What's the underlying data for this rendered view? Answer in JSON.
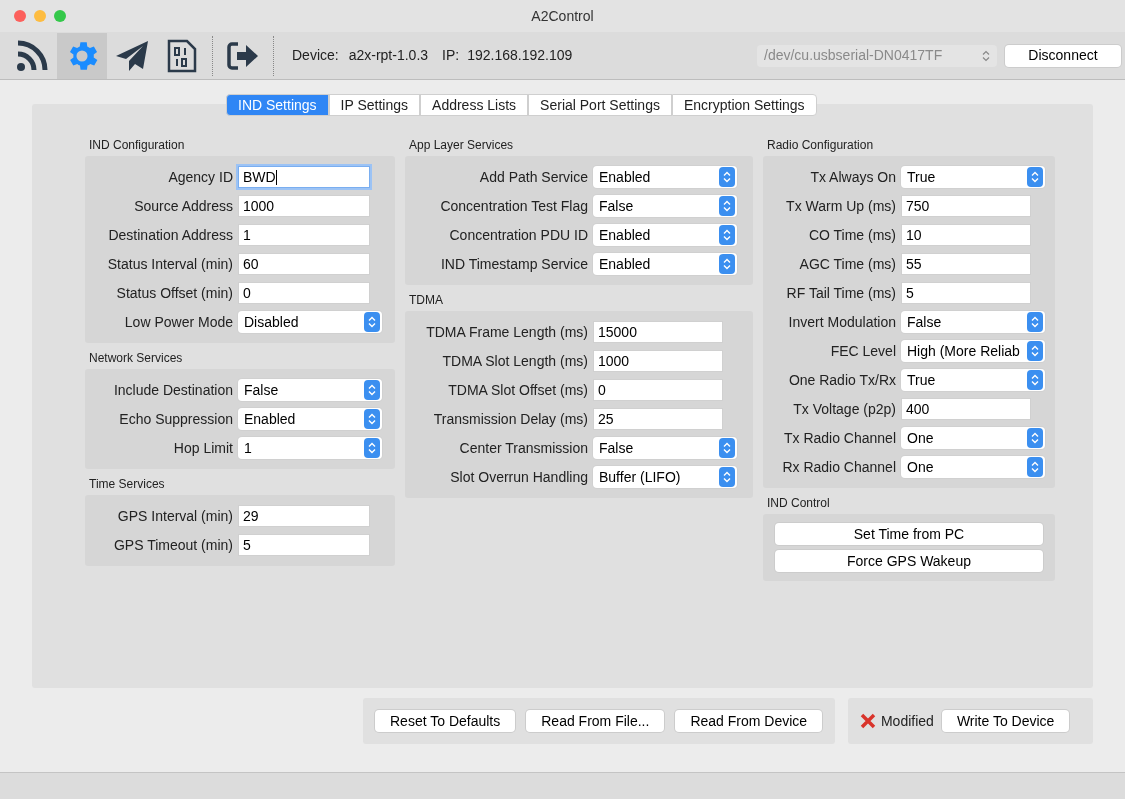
{
  "window": {
    "title": "A2Control"
  },
  "toolbar": {
    "icons": [
      {
        "kind": "feed",
        "selected": false
      },
      {
        "kind": "gear",
        "selected": true
      },
      {
        "kind": "plane",
        "selected": false
      },
      {
        "kind": "sim",
        "selected": false
      },
      {
        "kind": "exit",
        "selected": false
      }
    ],
    "device_label": "Device:",
    "device": "a2x-rpt-1.0.3",
    "ip_label": "IP:",
    "ip": "192.168.192.109",
    "port": {
      "value": "/dev/cu.usbserial-DN0417TF",
      "disabled": true
    },
    "connect_button": "Disconnect"
  },
  "tabs": [
    {
      "label": "IND Settings",
      "selected": true
    },
    {
      "label": "IP Settings",
      "selected": false
    },
    {
      "label": "Address Lists",
      "selected": false
    },
    {
      "label": "Serial Port Settings",
      "selected": false
    },
    {
      "label": "Encryption Settings",
      "selected": false
    }
  ],
  "columns": [
    [
      {
        "title": "IND Configuration",
        "rows": [
          {
            "label": "Agency ID",
            "kind": "text",
            "value": "BWD",
            "focused": true
          },
          {
            "label": "Source Address",
            "kind": "text",
            "value": "1000",
            "focused": false
          },
          {
            "label": "Destination Address",
            "kind": "text",
            "value": "1",
            "focused": false
          },
          {
            "label": "Status Interval (min)",
            "kind": "text",
            "value": "60",
            "focused": false
          },
          {
            "label": "Status Offset (min)",
            "kind": "text",
            "value": "0",
            "focused": false
          },
          {
            "label": "Low Power Mode",
            "kind": "select",
            "value": "Disabled"
          }
        ]
      },
      {
        "title": "Network Services",
        "rows": [
          {
            "label": "Include Destination",
            "kind": "select",
            "value": "False"
          },
          {
            "label": "Echo Suppression",
            "kind": "select",
            "value": "Enabled"
          },
          {
            "label": "Hop Limit",
            "kind": "select",
            "value": "1"
          }
        ]
      },
      {
        "title": "Time Services",
        "rows": [
          {
            "label": "GPS Interval (min)",
            "kind": "text",
            "value": "29",
            "focused": false
          },
          {
            "label": "GPS Timeout (min)",
            "kind": "text",
            "value": "5",
            "focused": false
          }
        ]
      }
    ],
    [
      {
        "title": "App Layer Services",
        "rows": [
          {
            "label": "Add Path Service",
            "kind": "select",
            "value": "Enabled"
          },
          {
            "label": "Concentration Test Flag",
            "kind": "select",
            "value": "False"
          },
          {
            "label": "Concentration PDU ID",
            "kind": "select",
            "value": "Enabled"
          },
          {
            "label": "IND Timestamp Service",
            "kind": "select",
            "value": "Enabled"
          }
        ]
      },
      {
        "title": "TDMA",
        "rows": [
          {
            "label": "TDMA Frame Length (ms)",
            "kind": "text",
            "value": "15000",
            "focused": false
          },
          {
            "label": "TDMA Slot Length (ms)",
            "kind": "text",
            "value": "1000",
            "focused": false
          },
          {
            "label": "TDMA Slot Offset (ms)",
            "kind": "text",
            "value": "0",
            "focused": false
          },
          {
            "label": "Transmission Delay (ms)",
            "kind": "text",
            "value": "25",
            "focused": false
          },
          {
            "label": "Center Transmission",
            "kind": "select",
            "value": "False"
          },
          {
            "label": "Slot Overrun Handling",
            "kind": "select",
            "value": "Buffer (LIFO)"
          }
        ]
      }
    ],
    [
      {
        "title": "Radio Configuration",
        "rows": [
          {
            "label": "Tx Always On",
            "kind": "select",
            "value": "True"
          },
          {
            "label": "Tx Warm Up (ms)",
            "kind": "text",
            "value": "750",
            "focused": false
          },
          {
            "label": "CO Time (ms)",
            "kind": "text",
            "value": "10",
            "focused": false
          },
          {
            "label": "AGC Time (ms)",
            "kind": "text",
            "value": "55",
            "focused": false
          },
          {
            "label": "RF Tail Time (ms)",
            "kind": "text",
            "value": "5",
            "focused": false
          },
          {
            "label": "Invert Modulation",
            "kind": "select",
            "value": "False"
          },
          {
            "label": "FEC Level",
            "kind": "select",
            "value": "High (More Reliab"
          },
          {
            "label": "One Radio Tx/Rx",
            "kind": "select",
            "value": "True"
          },
          {
            "label": "Tx Voltage (p2p)",
            "kind": "text",
            "value": "400",
            "focused": false
          },
          {
            "label": "Tx Radio Channel",
            "kind": "select",
            "value": "One"
          },
          {
            "label": "Rx Radio Channel",
            "kind": "select",
            "value": "One"
          }
        ]
      },
      {
        "title": "IND Control",
        "buttons": [
          "Set Time from PC",
          "Force GPS Wakeup"
        ]
      }
    ]
  ],
  "file_buttons": [
    "Reset To Defaults",
    "Read From File...",
    "Read From Device"
  ],
  "status": {
    "modified": true,
    "label": "Modified"
  },
  "write_button": "Write To Device"
}
